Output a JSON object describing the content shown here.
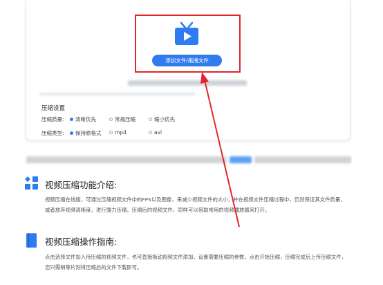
{
  "upload": {
    "button_label": "添加文件/拖拽文件"
  },
  "settings": {
    "title": "压缩设置",
    "quality": {
      "label": "压缩质量:",
      "options": [
        "清晰优先",
        "常规压缩",
        "缩小优先"
      ],
      "selected": "清晰优先"
    },
    "type": {
      "label": "压缩类型:",
      "options": [
        "保持原格式",
        "mp4",
        "avi"
      ],
      "selected": "保持原格式"
    }
  },
  "intro": {
    "heading": "视频压缩功能介绍:",
    "paragraph": "视频压缩在线版，可通过压缩视频文件中的FPS以及图像，来减少视频文件的大小，并在视频文件压缩过程中，仍然保证其文件质量，或者放弃视频清晰度，进行强力压缩。压缩后的视频文件，同样可以借助常用的视频播放器来打开。"
  },
  "guide": {
    "heading": "视频压缩操作指南:",
    "paragraph": "点击选择文件加入待压缩的视频文件，也可直接拖动视频文件添加，设置需要压缩的参数，点击开始压缩，压缩完成后上传压缩文件，您只需稍等片刻将压缩后的文件下载即可。"
  },
  "colors": {
    "accent": "#2f7cf0",
    "highlight": "#e0262b"
  },
  "icons": {
    "upload": "tv-play-icon",
    "intro": "grid-blocks-icon",
    "guide": "book-icon"
  }
}
